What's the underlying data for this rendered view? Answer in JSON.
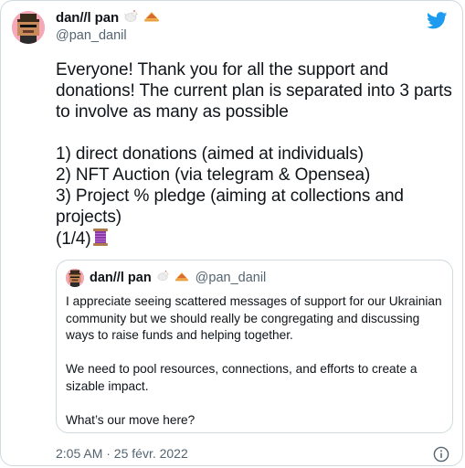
{
  "tweet": {
    "author_name": "dan//l pan",
    "author_handle": "@pan_danil",
    "name_emojis": [
      "rooster-emoji",
      "pie-emoji"
    ],
    "text": "Everyone! Thank you for all the support and donations! The current plan is separated into 3 parts to involve as many as possible\n\n1) direct donations (aimed at individuals)\n2) NFT Auction (via telegram & Opensea)\n3) Project % pledge (aiming at collections and projects)\n(1/4)",
    "text_trailing_emoji": "thread-spool-emoji",
    "timestamp": "2:05 AM · 25 févr. 2022"
  },
  "quoted_tweet": {
    "author_name": "dan//l pan",
    "author_handle": "@pan_danil",
    "text": "I appreciate seeing scattered messages of support for our Ukrainian community but we should really be congregating and discussing ways to raise funds and helping together.\n\nWe need to pool resources, connections, and efforts to create a sizable impact.\n\nWhat’s our move here?"
  },
  "colors": {
    "twitter_blue": "#1d9bf0",
    "text_primary": "#0f1419",
    "text_secondary": "#536471",
    "border": "#cfd9de"
  }
}
